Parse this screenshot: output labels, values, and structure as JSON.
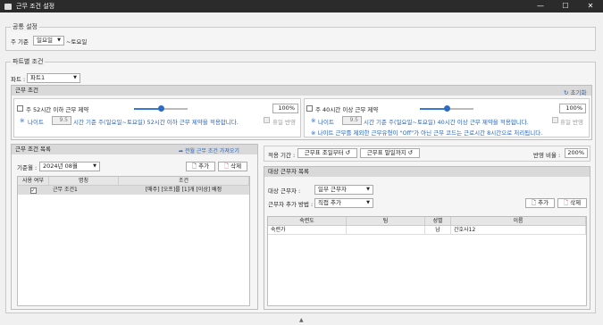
{
  "window": {
    "title": "근무 조건 설정",
    "minimize": "—",
    "maximize": "☐",
    "close": "✕"
  },
  "common": {
    "legend": "공통 설정",
    "week_label": "주 기준",
    "week_value": "일요일",
    "week_suffix": "~토요일"
  },
  "part": {
    "legend": "파트별 조건",
    "part_label": "파트 :",
    "part_value": "파트1",
    "work_cond": {
      "title": "근무 조건",
      "reset_label": "초기화",
      "left": {
        "checkbox_label": "주 52시간 이하 근무 제약",
        "percent": "100%",
        "slider_fraction": 0.5,
        "prefix": "※",
        "night_label": "나이트",
        "night_value": "9.5",
        "desc": "시간 기준 주(일요일~토요일) 52시간 이하 근무 제약을 적용합니다.",
        "holiday_label": "휴일 반영"
      },
      "right": {
        "checkbox_label": "주 40시간 이상 근무 제약",
        "percent": "100%",
        "slider_fraction": 0.5,
        "prefix": "※",
        "night_label": "나이트",
        "night_value": "9.5",
        "desc": "시간 기준 주(일요일~토요일) 40시간 이상 근무 제약을 적용합니다.",
        "note": "※ 나이트 근무를 제외한 근무유형이 \"Off\"가 아닌 근무 코드는 근로시간 8시간으로 처리됩니다.",
        "holiday_label": "휴일 반영"
      }
    },
    "cond_list": {
      "title": "근무 조건 목록",
      "import_label": "전월 근무 조건 가져오기",
      "month_label": "기준월 :",
      "month_value": "2024년 08월",
      "add_label": "추가",
      "delete_label": "삭제",
      "columns": [
        "사용 여부",
        "명칭",
        "조건"
      ],
      "rows": [
        {
          "used": "✓",
          "name": "근무 조건1",
          "condition": "[매주] [오프]를 [1]개 [이상] 배정"
        }
      ]
    },
    "apply": {
      "label": "적용 기간 :",
      "start": "근무표 조일부터",
      "end": "근무표 말일까지",
      "ratio_label": "반영 비율 :",
      "ratio_value": "200%"
    },
    "targets": {
      "title": "대상 근무자 목록",
      "target_label": "대상 근무자 :",
      "target_value": "일부 근무자",
      "method_label": "근무자 추가 방법 :",
      "method_value": "직접 추가",
      "add_label": "추가",
      "delete_label": "삭제",
      "columns": [
        "숙련도",
        "팀",
        "성별",
        "이름"
      ],
      "rows": [
        {
          "skill": "숙련가",
          "team": "",
          "gender": "남",
          "name": "간호사12"
        }
      ]
    }
  }
}
